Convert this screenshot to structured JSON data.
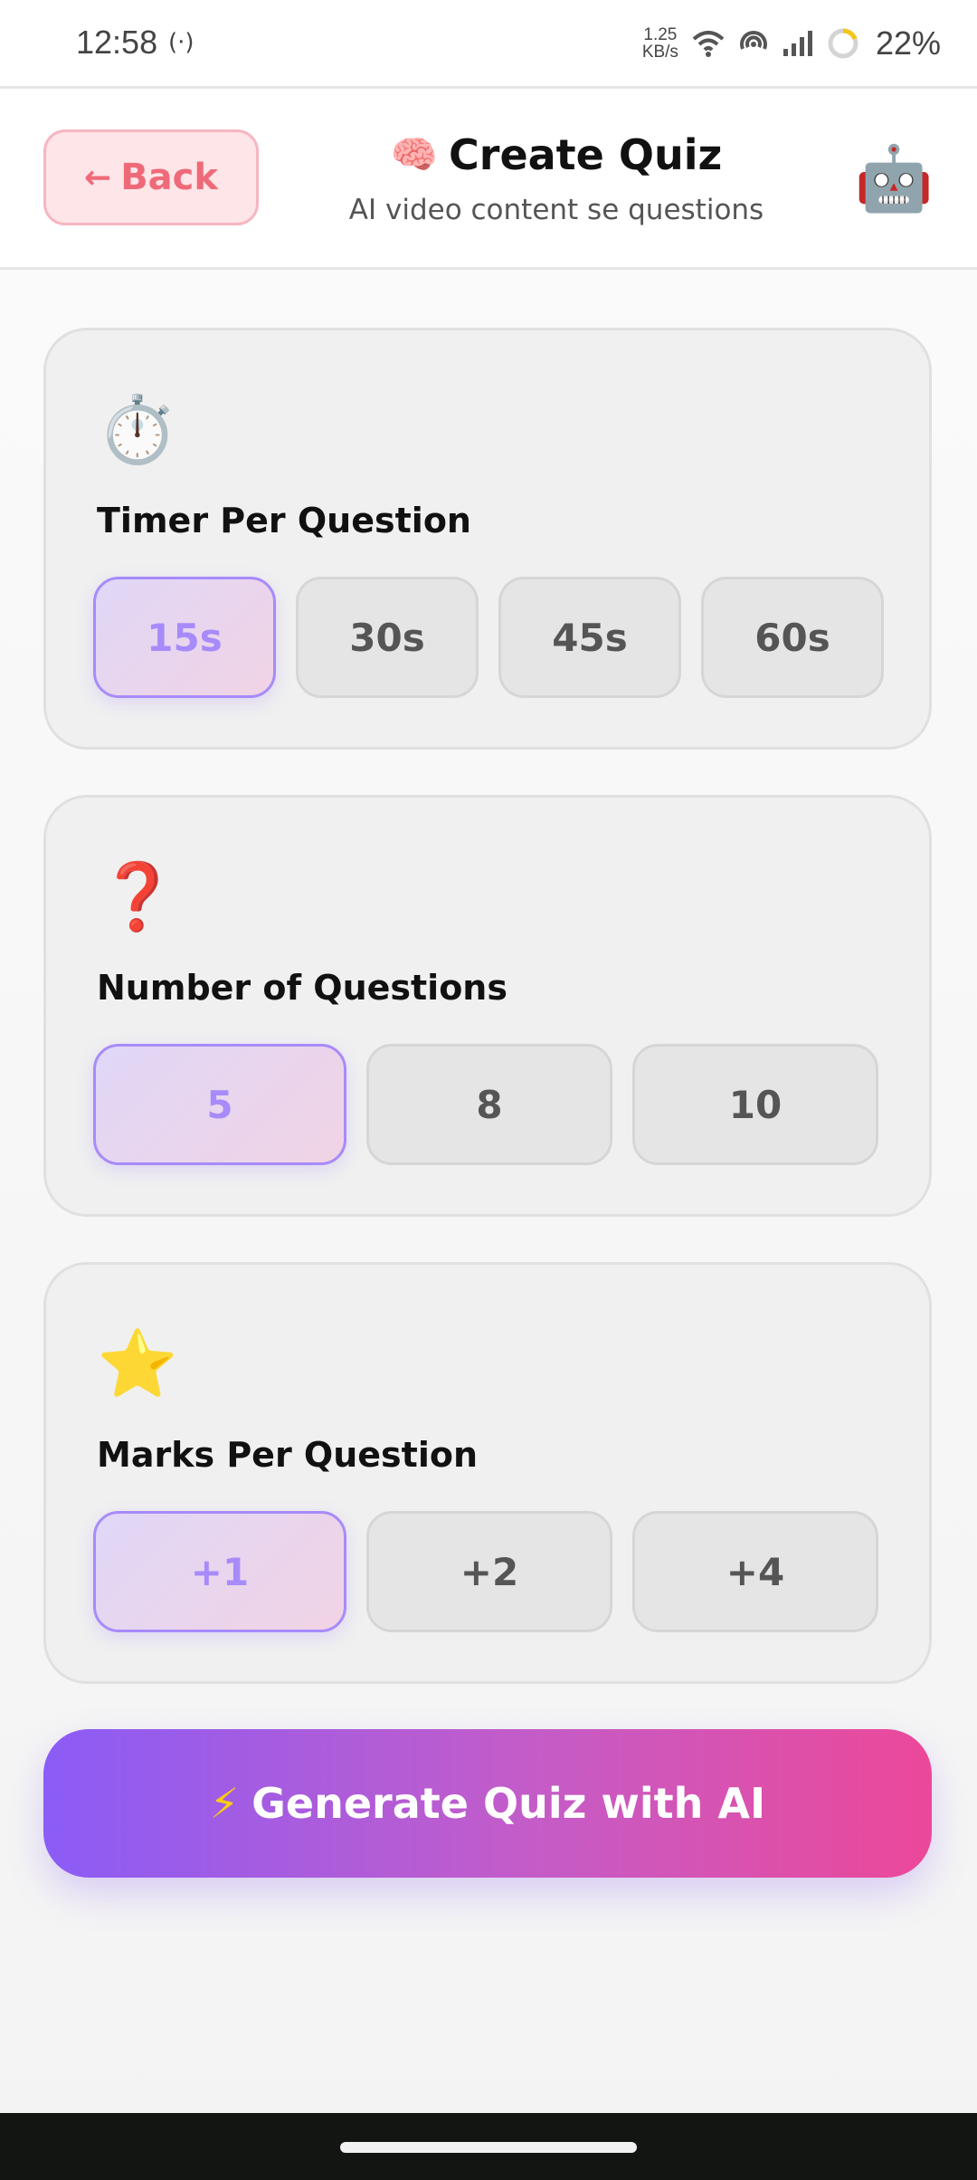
{
  "status": {
    "time": "12:58",
    "net_speed_value": "1.25",
    "net_speed_unit": "KB/s",
    "battery": "22%",
    "hotspot_glyph": "(·)"
  },
  "header": {
    "back_label": "Back",
    "back_arrow": "←",
    "title_icon": "🧠",
    "title": "Create Quiz",
    "subtitle": "AI video content se questions",
    "mascot_icon": "🤖"
  },
  "timer": {
    "icon": "⏱️",
    "title": "Timer Per Question",
    "options": [
      "15s",
      "30s",
      "45s",
      "60s"
    ],
    "selected": "15s"
  },
  "questions": {
    "icon": "❓",
    "title": "Number of Questions",
    "options": [
      "5",
      "8",
      "10"
    ],
    "selected": "5"
  },
  "marks": {
    "icon": "⭐",
    "title": "Marks Per Question",
    "options": [
      "+1",
      "+2",
      "+4"
    ],
    "selected": "+1"
  },
  "generate": {
    "icon": "⚡",
    "label": "Generate Quiz with AI"
  },
  "colors": {
    "accent": "#a78bfa",
    "back": "#ef6a78",
    "gradient_start": "#8b5cf6",
    "gradient_end": "#ec4899"
  }
}
